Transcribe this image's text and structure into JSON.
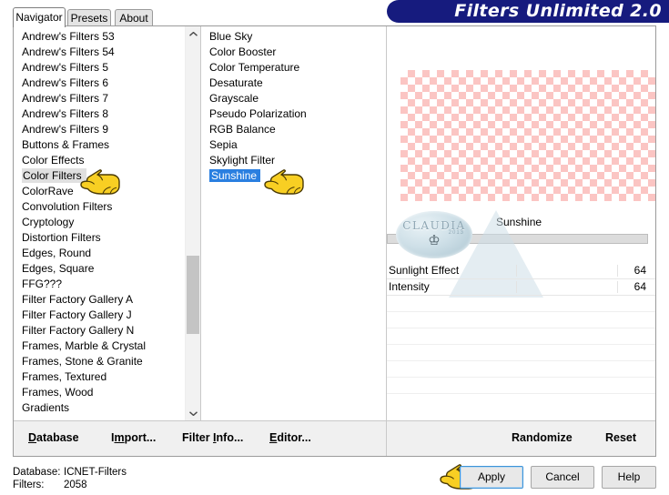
{
  "window": {
    "banner_title": "Filters Unlimited 2.0"
  },
  "tabs": [
    {
      "label": "Navigator",
      "active": true
    },
    {
      "label": "Presets",
      "active": false
    },
    {
      "label": "About",
      "active": false
    }
  ],
  "categories": {
    "selected": "Color Filters",
    "items": [
      "Andrew's Filters 53",
      "Andrew's Filters 54",
      "Andrew's Filters 5",
      "Andrew's Filters 6",
      "Andrew's Filters 7",
      "Andrew's Filters 8",
      "Andrew's Filters 9",
      "Buttons & Frames",
      "Color Effects",
      "Color Filters",
      "ColorRave",
      "Convolution Filters",
      "Cryptology",
      "Distortion Filters",
      "Edges, Round",
      "Edges, Square",
      "FFG???",
      "Filter Factory Gallery A",
      "Filter Factory Gallery J",
      "Filter Factory Gallery N",
      "Frames, Marble & Crystal",
      "Frames, Stone & Granite",
      "Frames, Textured",
      "Frames, Wood",
      "Gradients"
    ]
  },
  "filters": {
    "selected": "Sunshine",
    "items": [
      "Blue Sky",
      "Color Booster",
      "Color Temperature",
      "Desaturate",
      "Grayscale",
      "Pseudo Polarization",
      "RGB Balance",
      "Sepia",
      "Skylight Filter",
      "Sunshine"
    ]
  },
  "preview": {
    "filter_title": "Sunshine",
    "logo_text": "CLAUDIA",
    "logo_subtext": "2013"
  },
  "parameters": [
    {
      "name": "Sunlight Effect",
      "value": "64"
    },
    {
      "name": "Intensity",
      "value": "64"
    }
  ],
  "commands": {
    "database": {
      "pre": "",
      "key": "D",
      "post": "atabase"
    },
    "import": {
      "pre": "I",
      "key": "m",
      "post": "port..."
    },
    "filter_info": {
      "pre": "Filter ",
      "key": "I",
      "post": "nfo..."
    },
    "editor": {
      "pre": "",
      "key": "E",
      "post": "ditor..."
    },
    "randomize": "Randomize",
    "reset": "Reset"
  },
  "status": {
    "database_label": "Database:",
    "database_value": "ICNET-Filters",
    "filters_label": "Filters:",
    "filters_value": "2058"
  },
  "buttons": {
    "apply": "Apply",
    "cancel": "Cancel",
    "help": "Help"
  },
  "colors": {
    "banner_blue": "#161b7e",
    "selection_blue": "#2a7fe0",
    "selection_gray": "#e0e0e0",
    "checker_pink": "#fbc5c3",
    "focus_outline": "#3c93d8"
  }
}
